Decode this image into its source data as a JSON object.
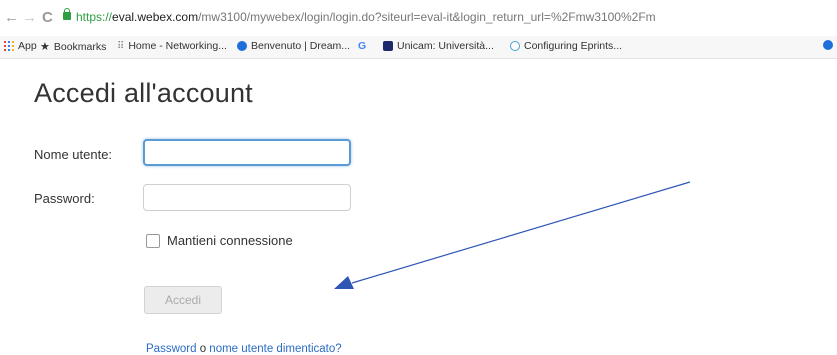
{
  "browser": {
    "back": "←",
    "forward": "→",
    "reload": "C",
    "url_scheme": "https://",
    "url_host": "eval.webex.com",
    "url_path": "/mw3100/mywebex/login/login.do?siteurl=eval-it&login_return_url=%2Fmw3100%2Fm",
    "bookmarks": [
      {
        "label": "App"
      },
      {
        "label": "Bookmarks"
      },
      {
        "label": "Home - Networking..."
      },
      {
        "label": "Benvenuto | Dream..."
      },
      {
        "label": "G"
      },
      {
        "label": "Unicam: Università..."
      },
      {
        "label": "Configuring Eprints..."
      }
    ]
  },
  "login": {
    "title": "Accedi all'account",
    "username_label": "Nome utente:",
    "username_value": "",
    "password_label": "Password:",
    "password_value": "",
    "remember_label": "Mantieni connessione",
    "remember_checked": false,
    "submit_label": "Accedi",
    "forgot_password": "Password",
    "forgot_sep": " o ",
    "forgot_username": "nome utente dimenticato?"
  },
  "annotation": {
    "type": "arrow",
    "color": "#2f55b5"
  }
}
